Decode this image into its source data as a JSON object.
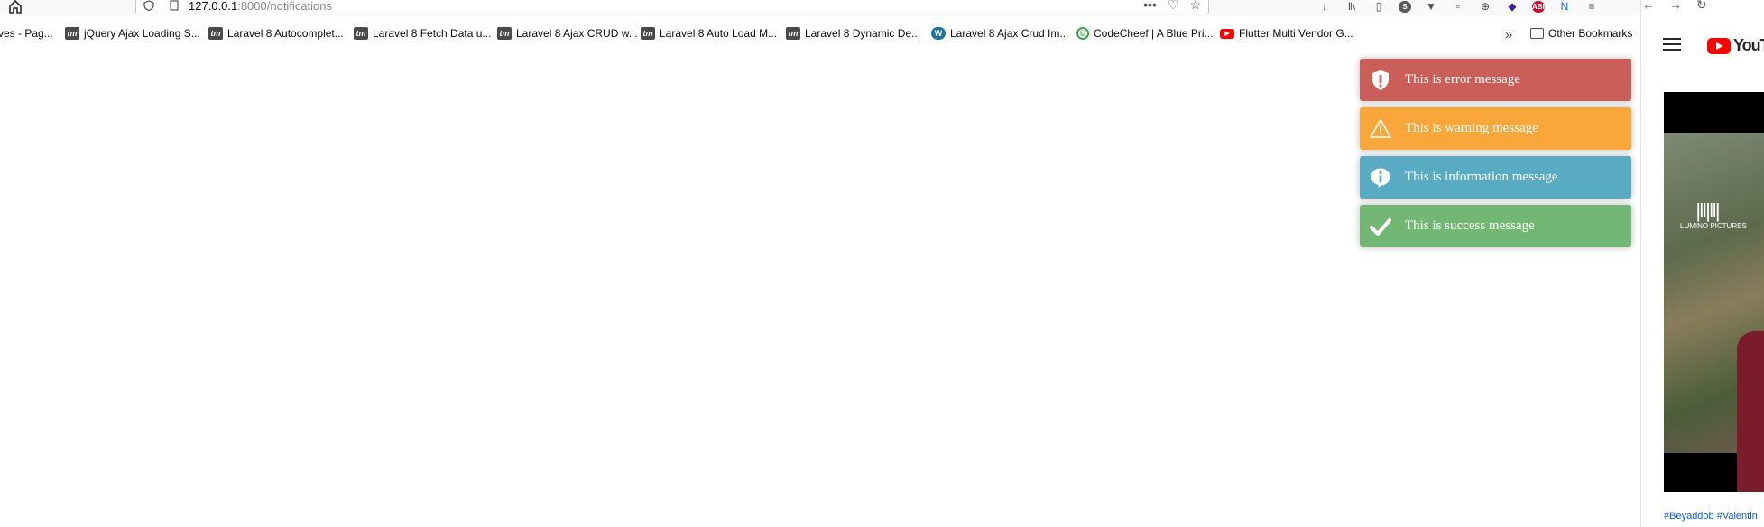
{
  "address_bar": {
    "url_host": "127.0.0.1",
    "url_rest": ":8000/notifications"
  },
  "bookmarks": [
    {
      "label": "ves - Pag...",
      "icon": "none"
    },
    {
      "label": "jQuery Ajax Loading S...",
      "icon": "tm-icon"
    },
    {
      "label": "Laravel 8 Autocomplet...",
      "icon": "tm-icon"
    },
    {
      "label": "Laravel 8 Fetch Data u...",
      "icon": "tm-icon"
    },
    {
      "label": "Laravel 8 Ajax CRUD w...",
      "icon": "tm-icon"
    },
    {
      "label": "Laravel 8 Auto Load M...",
      "icon": "tm-icon"
    },
    {
      "label": "Laravel 8 Dynamic De...",
      "icon": "tm-icon"
    },
    {
      "label": "Laravel 8 Ajax Crud Im...",
      "icon": "wordpress-icon"
    },
    {
      "label": "CodeCheef | A Blue Pri...",
      "icon": "codecheef-icon"
    },
    {
      "label": "Flutter Multi Vendor G...",
      "icon": "youtube-icon"
    }
  ],
  "other_bookmarks": "Other Bookmarks",
  "toasts": [
    {
      "type": "error",
      "message": "This is error message",
      "icon": "shield-exclamation-icon",
      "color": "#ca5e58"
    },
    {
      "type": "warning",
      "message": "This is warning message",
      "icon": "warning-triangle-icon",
      "color": "#f9a73b"
    },
    {
      "type": "info",
      "message": "This is information message",
      "icon": "info-icon",
      "color": "#58abc3"
    },
    {
      "type": "success",
      "message": "This is success message",
      "icon": "checkmark-icon",
      "color": "#72b774"
    }
  ],
  "side_window": {
    "logo_text": "YouTu",
    "video_logo": "LUMINO PICTURES",
    "hashtags": "#Beyaddob #Valentin"
  }
}
